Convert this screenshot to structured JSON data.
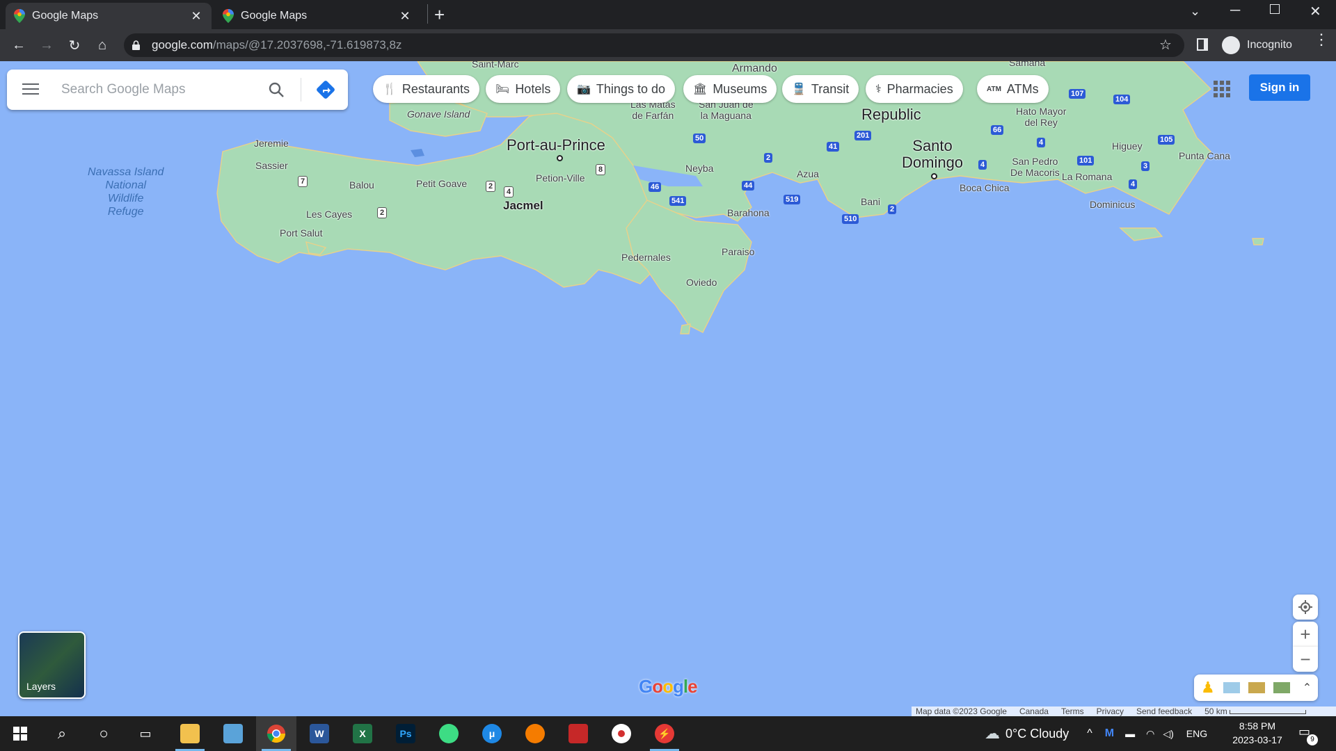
{
  "browser": {
    "tabs": [
      {
        "title": "Google Maps",
        "active": true
      },
      {
        "title": "Google Maps",
        "active": false
      }
    ],
    "url_host": "google.com",
    "url_path": "/maps/@17.2037698,-71.619873,8z",
    "profile_label": "Incognito"
  },
  "search": {
    "placeholder": "Search Google Maps"
  },
  "chips": [
    {
      "label": "Restaurants",
      "icon": "fork-knife-icon"
    },
    {
      "label": "Hotels",
      "icon": "bed-icon"
    },
    {
      "label": "Things to do",
      "icon": "camera-icon"
    },
    {
      "label": "Museums",
      "icon": "museum-icon"
    },
    {
      "label": "Transit",
      "icon": "train-icon"
    },
    {
      "label": "Pharmacies",
      "icon": "pharmacy-icon"
    },
    {
      "label": "ATMs",
      "icon": "atm-icon"
    }
  ],
  "sign_in": "Sign in",
  "map": {
    "places": {
      "port_au_prince": "Port-au-Prince",
      "santo_domingo": "Santo\nDomingo",
      "republic": "Republic",
      "jacmel": "Jacmel",
      "petion_ville": "Petion-Ville",
      "jeremie": "Jeremie",
      "sassier": "Sassier",
      "balou": "Balou",
      "petit_goave": "Petit Goave",
      "les_cayes": "Les Cayes",
      "port_salut": "Port Salut",
      "neyba": "Neyba",
      "azua": "Azua",
      "barahona": "Barahona",
      "pedernales": "Pedernales",
      "paraiso": "Paraiso",
      "oviedo": "Oviedo",
      "bani": "Bani",
      "boca_chica": "Boca Chica",
      "san_pedro": "San Pedro\nDe Macoris",
      "la_romana": "La Romana",
      "dominicus": "Dominicus",
      "higuey": "Higuey",
      "punta_cana": "Punta Cana",
      "hato_mayor": "Hato Mayor\ndel Rey",
      "gonave": "Gonave Island",
      "saint_marc": "Saint-Marc",
      "armando": "Armando",
      "las_matas": "Las Matas\nde Farfán",
      "maguana": "San Juan de\nla Maguana",
      "samana": "Samana",
      "navassa": "Navassa Island\nNational\nWildlife\nRefuge"
    },
    "route_shields": [
      "7",
      "2",
      "2",
      "4",
      "8",
      "46",
      "541",
      "50",
      "2",
      "44",
      "519",
      "201",
      "41",
      "2",
      "510",
      "66",
      "4",
      "101",
      "3",
      "4",
      "105",
      "104",
      "107",
      "4"
    ],
    "google_logo": "Google",
    "layers_label": "Layers",
    "footer": [
      "Map data ©2023 Google",
      "Canada",
      "Terms",
      "Privacy",
      "Send feedback",
      "50 km"
    ]
  },
  "taskbar": {
    "weather": "0°C  Cloudy",
    "lang": "ENG",
    "time": "8:58 PM",
    "date": "2023-03-17",
    "notifications": "9"
  }
}
